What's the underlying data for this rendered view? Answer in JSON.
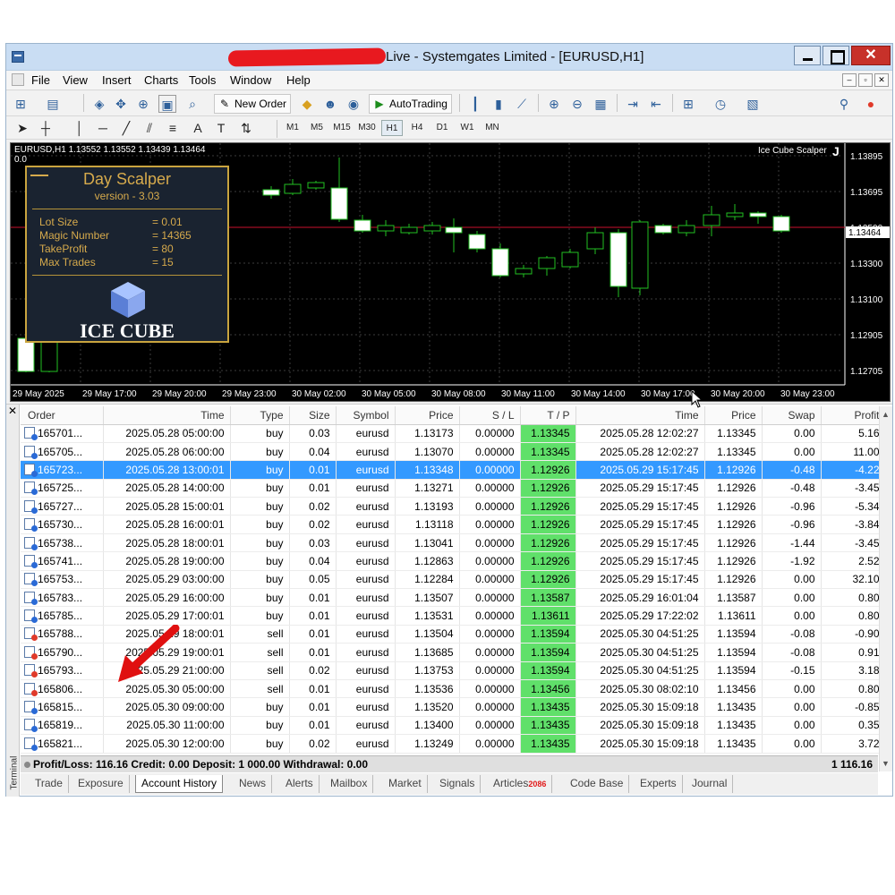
{
  "window": {
    "title": "Live - Systemgates Limited - [EURUSD,H1]"
  },
  "menu": [
    "File",
    "View",
    "Insert",
    "Charts",
    "Tools",
    "Window",
    "Help"
  ],
  "toolbar": {
    "new_order": "New Order",
    "autotrading": "AutoTrading"
  },
  "timeframes": [
    "M1",
    "M5",
    "M15",
    "M30",
    "H1",
    "H4",
    "D1",
    "W1",
    "MN"
  ],
  "active_timeframe": "H1",
  "chart": {
    "header": "EURUSD,H1  1.13552 1.13552 1.13439 1.13464",
    "zero": "0.0",
    "ea_name": "Ice Cube Scalper",
    "ea_flag": "J",
    "price_labels": [
      "1.13895",
      "1.13695",
      "1.13500",
      "1.13300",
      "1.13100",
      "1.12905",
      "1.12705"
    ],
    "current_price": "1.13464",
    "time_labels": [
      "29 May 2025",
      "29 May 17:00",
      "29 May 20:00",
      "29 May 23:00",
      "30 May 02:00",
      "30 May 05:00",
      "30 May 08:00",
      "30 May 11:00",
      "30 May 14:00",
      "30 May 17:00",
      "30 May 20:00",
      "30 May 23:00"
    ]
  },
  "panel": {
    "title": "Day Scalper",
    "version": "version - 3.03",
    "rows": [
      {
        "label": "Lot Size",
        "value": "= 0.01"
      },
      {
        "label": "Magic Number",
        "value": "= 14365"
      },
      {
        "label": "TakeProfit",
        "value": "= 80"
      },
      {
        "label": "Max Trades",
        "value": "= 15"
      }
    ],
    "logo_text": "ICE CUBE"
  },
  "table": {
    "headers": [
      "Order",
      "Time",
      "Type",
      "Size",
      "Symbol",
      "Price",
      "S / L",
      "T / P",
      "Time",
      "Price",
      "Swap",
      "Profit"
    ],
    "rows": [
      [
        "165701...",
        "2025.05.28 05:00:00",
        "buy",
        "0.03",
        "eurusd",
        "1.13173",
        "0.00000",
        "1.13345",
        "2025.05.28 12:02:27",
        "1.13345",
        "0.00",
        "5.16"
      ],
      [
        "165705...",
        "2025.05.28 06:00:00",
        "buy",
        "0.04",
        "eurusd",
        "1.13070",
        "0.00000",
        "1.13345",
        "2025.05.28 12:02:27",
        "1.13345",
        "0.00",
        "11.00"
      ],
      [
        "165723...",
        "2025.05.28 13:00:01",
        "buy",
        "0.01",
        "eurusd",
        "1.13348",
        "0.00000",
        "1.12926",
        "2025.05.29 15:17:45",
        "1.12926",
        "-0.48",
        "-4.22"
      ],
      [
        "165725...",
        "2025.05.28 14:00:00",
        "buy",
        "0.01",
        "eurusd",
        "1.13271",
        "0.00000",
        "1.12926",
        "2025.05.29 15:17:45",
        "1.12926",
        "-0.48",
        "-3.45"
      ],
      [
        "165727...",
        "2025.05.28 15:00:01",
        "buy",
        "0.02",
        "eurusd",
        "1.13193",
        "0.00000",
        "1.12926",
        "2025.05.29 15:17:45",
        "1.12926",
        "-0.96",
        "-5.34"
      ],
      [
        "165730...",
        "2025.05.28 16:00:01",
        "buy",
        "0.02",
        "eurusd",
        "1.13118",
        "0.00000",
        "1.12926",
        "2025.05.29 15:17:45",
        "1.12926",
        "-0.96",
        "-3.84"
      ],
      [
        "165738...",
        "2025.05.28 18:00:01",
        "buy",
        "0.03",
        "eurusd",
        "1.13041",
        "0.00000",
        "1.12926",
        "2025.05.29 15:17:45",
        "1.12926",
        "-1.44",
        "-3.45"
      ],
      [
        "165741...",
        "2025.05.28 19:00:00",
        "buy",
        "0.04",
        "eurusd",
        "1.12863",
        "0.00000",
        "1.12926",
        "2025.05.29 15:17:45",
        "1.12926",
        "-1.92",
        "2.52"
      ],
      [
        "165753...",
        "2025.05.29 03:00:00",
        "buy",
        "0.05",
        "eurusd",
        "1.12284",
        "0.00000",
        "1.12926",
        "2025.05.29 15:17:45",
        "1.12926",
        "0.00",
        "32.10"
      ],
      [
        "165783...",
        "2025.05.29 16:00:00",
        "buy",
        "0.01",
        "eurusd",
        "1.13507",
        "0.00000",
        "1.13587",
        "2025.05.29 16:01:04",
        "1.13587",
        "0.00",
        "0.80"
      ],
      [
        "165785...",
        "2025.05.29 17:00:01",
        "buy",
        "0.01",
        "eurusd",
        "1.13531",
        "0.00000",
        "1.13611",
        "2025.05.29 17:22:02",
        "1.13611",
        "0.00",
        "0.80"
      ],
      [
        "165788...",
        "2025.05.29 18:00:01",
        "sell",
        "0.01",
        "eurusd",
        "1.13504",
        "0.00000",
        "1.13594",
        "2025.05.30 04:51:25",
        "1.13594",
        "-0.08",
        "-0.90"
      ],
      [
        "165790...",
        "2025.05.29 19:00:01",
        "sell",
        "0.01",
        "eurusd",
        "1.13685",
        "0.00000",
        "1.13594",
        "2025.05.30 04:51:25",
        "1.13594",
        "-0.08",
        "0.91"
      ],
      [
        "165793...",
        "2025.05.29 21:00:00",
        "sell",
        "0.02",
        "eurusd",
        "1.13753",
        "0.00000",
        "1.13594",
        "2025.05.30 04:51:25",
        "1.13594",
        "-0.15",
        "3.18"
      ],
      [
        "165806...",
        "2025.05.30 05:00:00",
        "sell",
        "0.01",
        "eurusd",
        "1.13536",
        "0.00000",
        "1.13456",
        "2025.05.30 08:02:10",
        "1.13456",
        "0.00",
        "0.80"
      ],
      [
        "165815...",
        "2025.05.30 09:00:00",
        "buy",
        "0.01",
        "eurusd",
        "1.13520",
        "0.00000",
        "1.13435",
        "2025.05.30 15:09:18",
        "1.13435",
        "0.00",
        "-0.85"
      ],
      [
        "165819...",
        "2025.05.30 11:00:00",
        "buy",
        "0.01",
        "eurusd",
        "1.13400",
        "0.00000",
        "1.13435",
        "2025.05.30 15:09:18",
        "1.13435",
        "0.00",
        "0.35"
      ],
      [
        "165821...",
        "2025.05.30 12:00:00",
        "buy",
        "0.02",
        "eurusd",
        "1.13249",
        "0.00000",
        "1.13435",
        "2025.05.30 15:09:18",
        "1.13435",
        "0.00",
        "3.72"
      ]
    ],
    "selected_row": 2
  },
  "summary": {
    "text": "Profit/Loss: 116.16  Credit: 0.00  Deposit: 1 000.00  Withdrawal: 0.00",
    "total": "1 116.16"
  },
  "terminal_label": "Terminal",
  "tabs": [
    "Trade",
    "Exposure",
    "Account History",
    "News",
    "Alerts",
    "Mailbox",
    "Market",
    "Signals",
    "Articles",
    "Code Base",
    "Experts",
    "Journal"
  ],
  "articles_badge": "2086",
  "active_tab": "Account History"
}
